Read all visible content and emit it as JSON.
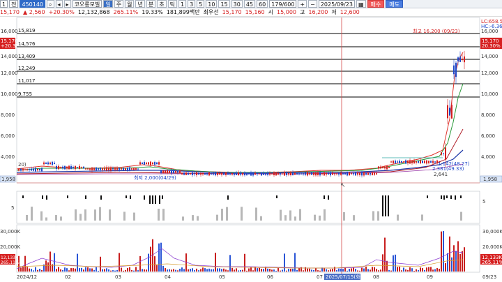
{
  "toolbar": {
    "code": "450140",
    "name": "코오롱모빌",
    "periods": [
      "주",
      "월",
      "년",
      "분",
      "초",
      "틱"
    ],
    "minutes": [
      "1",
      "3",
      "5",
      "10",
      "15",
      "30",
      "45",
      "60"
    ],
    "count": "179/600",
    "date": "2025/09/23",
    "buy": "매수",
    "sell": "매도",
    "prefix_label": "1",
    "view_label": "전"
  },
  "quote": {
    "price": "15,170",
    "change": "▲ 2,560",
    "change_pct": "+20.30%",
    "volume": "12,132,868",
    "vol_ratio": "265.11%",
    "turnover": "19.33%",
    "amount": "181,899백만",
    "best": "최우선",
    "best_ask": "15,170",
    "best_bid": "15,160",
    "open_label": "시",
    "open": "15,000",
    "high_label": "고",
    "high": "16,200",
    "low_label": "저",
    "low": "12,600"
  },
  "price_axis": {
    "left": [
      "16,000",
      "14,000",
      "12,000",
      "10,000",
      "8,000",
      "6,000",
      "4,000"
    ],
    "right": [
      "16,000",
      "14,000",
      "12,000",
      "10,000",
      "8,000",
      "6,000",
      "4,000"
    ],
    "current_left": "15,170",
    "current_pct_left": "+20.30%",
    "current_right": "15,170",
    "current_pct_right": "20.30%",
    "low_marker": "1,958",
    "top_right_a": "LC:658.50",
    "top_right_b": "HC:-6.36"
  },
  "levels": [
    "15,819",
    "14,576",
    "13,409",
    "12,249",
    "11,017",
    "9,755"
  ],
  "annotations": {
    "high": "최고 16,200 (09/23)",
    "low": "최저 2,000(04/29)",
    "mid_a": "1.142(48.27)",
    "mid_b": "2.381(49.33)",
    "mid_c": "2,641",
    "left_label": "20)",
    "cursor_date": "2025/07/15(화)"
  },
  "indicator_axis": {
    "right": "5",
    "left": "5"
  },
  "volume_axis": {
    "right": [
      "30,000K",
      "20,000K",
      "10,000K"
    ],
    "left": [
      "30,000K",
      "20,000K",
      "10,000K"
    ],
    "current_right": "12,133K",
    "current_right_b": "265.11%",
    "current_left": "12,133K",
    "current_left_b": "265.11%"
  },
  "x_axis": [
    "2024/12",
    "02",
    "03",
    "04",
    "05",
    "06",
    "07",
    "08",
    "09",
    "09/23"
  ],
  "colors": {
    "up": "#d62020",
    "down": "#1c46c9",
    "level_line": "#000000",
    "cursor": "#d64a4a",
    "volume_up": "#c81e1e",
    "volume_down": "#2a55d6"
  }
}
